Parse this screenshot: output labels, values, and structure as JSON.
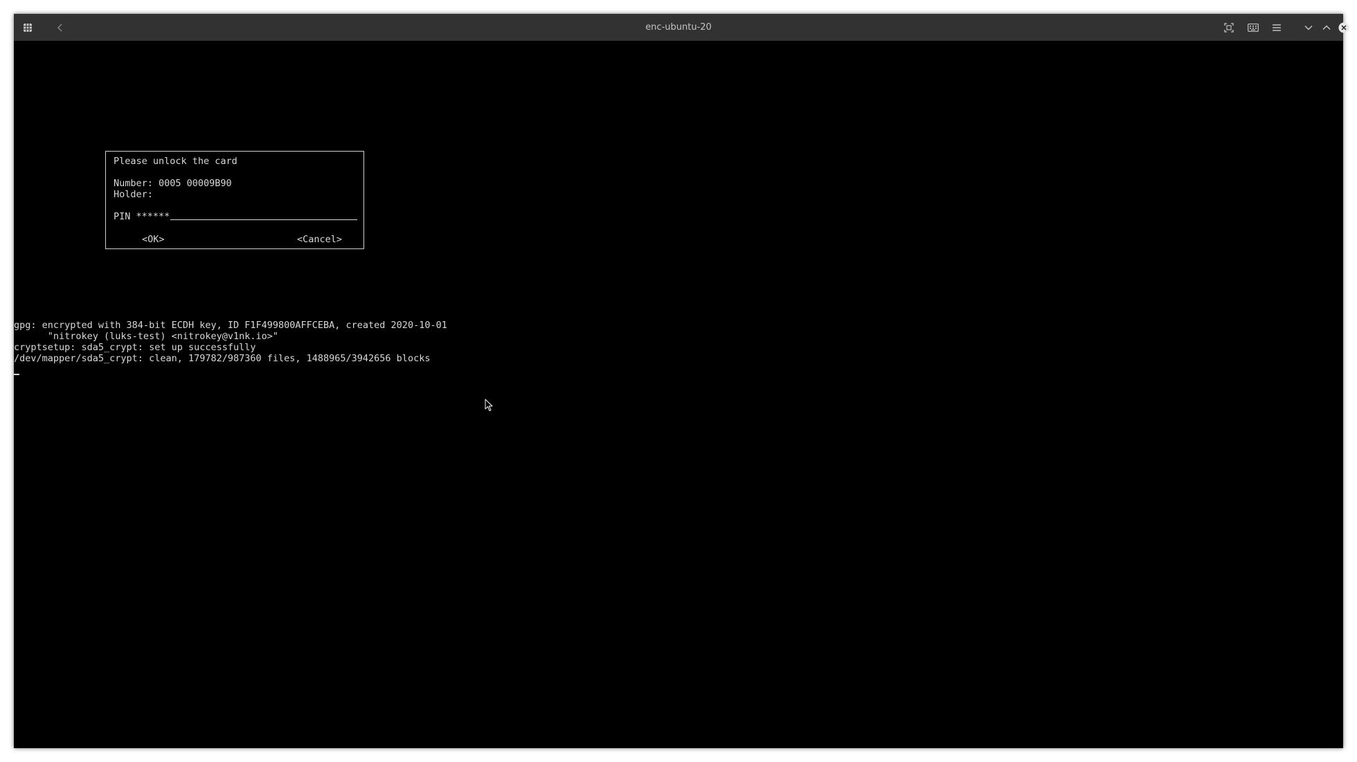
{
  "window": {
    "title": "enc-ubuntu-20"
  },
  "titlebar": {
    "left_icons": [
      "app-menu-icon",
      "back-chevron-icon"
    ],
    "right_icons": [
      "fullscreen-icon",
      "keyboard-icon",
      "hamburger-menu-icon",
      "minimize-icon",
      "maximize-icon",
      "close-icon"
    ]
  },
  "dialog": {
    "title": "Please unlock the card",
    "number_line": "Number: 0005 00009B90",
    "holder_line": "Holder:",
    "pin_label": "PIN ******",
    "ok_label": "<OK>",
    "cancel_label": "<Cancel>"
  },
  "terminal": {
    "lines": [
      "gpg: encrypted with 384-bit ECDH key, ID F1F499800AFFCEBA, created 2020-10-01",
      "      \"nitrokey (luks-test) <nitrokey@v1nk.io>\"",
      "cryptsetup: sda5_crypt: set up successfully",
      "/dev/mapper/sda5_crypt: clean, 179782/987360 files, 1488965/3942656 blocks"
    ]
  },
  "colors": {
    "titlebar_bg": "#323232",
    "title_text": "#c4c4c4",
    "terminal_bg": "#000000",
    "terminal_text": "#d8d8d8",
    "close_button": "#e6e6e6"
  }
}
